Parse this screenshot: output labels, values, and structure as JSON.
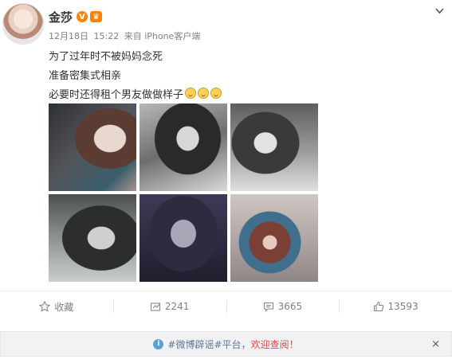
{
  "post": {
    "author": "金莎",
    "verified_label": "V",
    "meta": {
      "date": "12月18日",
      "time": "15:22",
      "source": "来自 iPhone客户端"
    },
    "lines": [
      "为了过年时不被妈妈念死",
      "准备密集式相亲",
      "必要时还得租个男友做做样子"
    ],
    "emoji_icons": [
      "laugh-emoji-icon",
      "laugh-emoji-icon",
      "laugh-emoji-icon"
    ],
    "photo_count": 6
  },
  "actions": {
    "favorite": "收藏",
    "repost": "2241",
    "comment": "3665",
    "like": "13593"
  },
  "notice": {
    "link": "#微博辟谣#平台",
    "separator": "，",
    "alert": "欢迎查阅！",
    "close": "×"
  },
  "colors": {
    "accent_orange": "#ff8200",
    "link_blue": "#5d7895",
    "alert_red": "#e34848",
    "info_blue": "#5e9fd6"
  }
}
